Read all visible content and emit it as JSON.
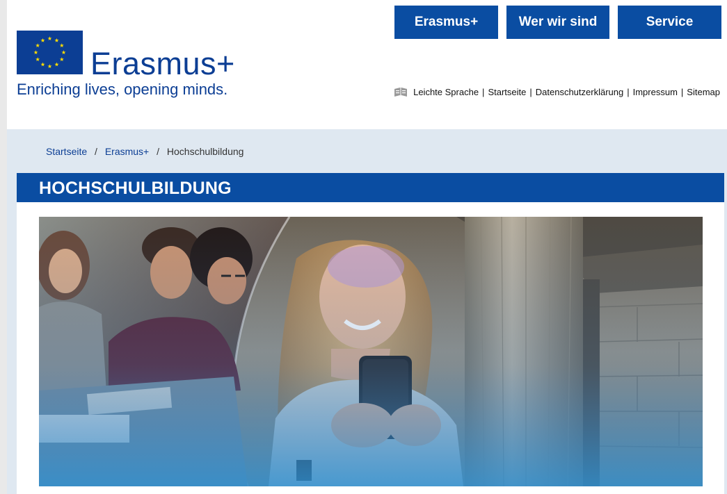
{
  "nav": {
    "items": [
      {
        "label": "Erasmus+"
      },
      {
        "label": "Wer wir sind"
      },
      {
        "label": "Service"
      }
    ]
  },
  "logo": {
    "wordmark": "Erasmus+",
    "tagline": "Enriching lives, opening minds."
  },
  "utility_links": [
    {
      "label": "Leichte Sprache",
      "icon": "easy-language-book-icon"
    },
    {
      "label": "Startseite"
    },
    {
      "label": "Datenschutzerklärung"
    },
    {
      "label": "Impressum"
    },
    {
      "label": "Sitemap"
    }
  ],
  "breadcrumb": [
    {
      "label": "Startseite"
    },
    {
      "label": "Erasmus+"
    },
    {
      "label": "Hochschulbildung"
    }
  ],
  "page_title": "HOCHSCHULBILDUNG",
  "colors": {
    "brand_blue": "#0a4da2",
    "logo_blue": "#0c3e94",
    "band": "#dfe8f1",
    "eu_gold": "#ffdd00"
  },
  "hero_image": {
    "icon": "students-smartphone-photo"
  }
}
